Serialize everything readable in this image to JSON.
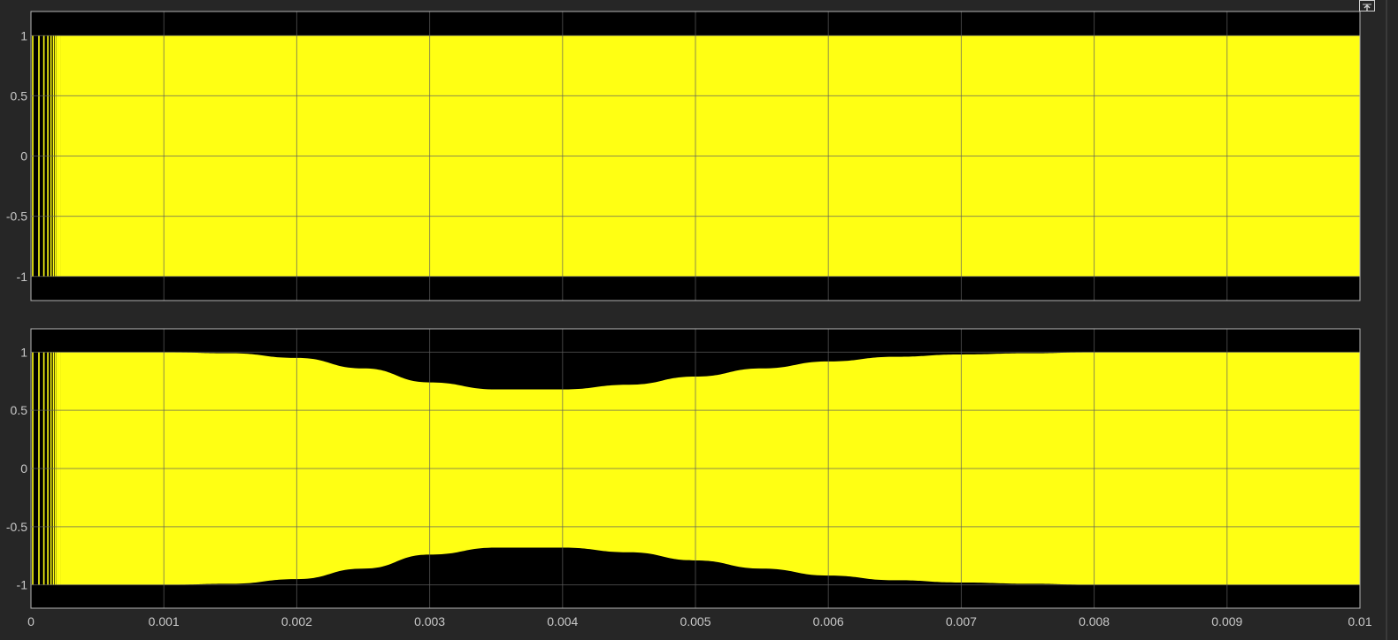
{
  "window": {
    "undock_icon": "undock-arrow-icon"
  },
  "colors": {
    "background": "#262626",
    "plot_background": "#000000",
    "signal": "#ffff13",
    "grid": "#5e5e5e",
    "axis_frame": "#b4b4b4",
    "tick_label": "#c8c8c8"
  },
  "chart_data": [
    {
      "type": "line",
      "title": "",
      "xlabel": "",
      "ylabel": "",
      "xlim": [
        0,
        0.01
      ],
      "ylim": [
        -1.2,
        1.2
      ],
      "grid": true,
      "x_tick_labels_shown": false,
      "xticks": [
        "0",
        "0.001",
        "0.002",
        "0.003",
        "0.004",
        "0.005",
        "0.006",
        "0.007",
        "0.008",
        "0.009",
        "0.01"
      ],
      "yticks": [
        "1",
        "0.5",
        "0",
        "-0.5",
        "-1"
      ],
      "series": [
        {
          "description_points": "upper/lower envelope of dense oscillation",
          "x": [
            0,
            0.0002,
            0.001,
            0.002,
            0.003,
            0.004,
            0.005,
            0.006,
            0.007,
            0.008,
            0.009,
            0.01
          ],
          "upper": [
            1,
            1,
            1,
            1,
            1,
            1,
            1,
            1,
            1,
            1,
            1,
            1
          ],
          "lower": [
            -1,
            -1,
            -1,
            -1,
            -1,
            -1,
            -1,
            -1,
            -1,
            -1,
            -1,
            -1
          ]
        }
      ]
    },
    {
      "type": "line",
      "title": "",
      "xlabel": "",
      "ylabel": "",
      "xlim": [
        0,
        0.01
      ],
      "ylim": [
        -1.2,
        1.2
      ],
      "grid": true,
      "x_tick_labels_shown": true,
      "xticks": [
        "0",
        "0.001",
        "0.002",
        "0.003",
        "0.004",
        "0.005",
        "0.006",
        "0.007",
        "0.008",
        "0.009",
        "0.01"
      ],
      "yticks": [
        "1",
        "0.5",
        "0",
        "-0.5",
        "-1"
      ],
      "series": [
        {
          "description_points": "upper/lower envelope of dense oscillation",
          "x": [
            0,
            0.0002,
            0.001,
            0.0015,
            0.002,
            0.0025,
            0.003,
            0.0035,
            0.004,
            0.0045,
            0.005,
            0.0055,
            0.006,
            0.0065,
            0.007,
            0.0075,
            0.008,
            0.009,
            0.01
          ],
          "upper": [
            1,
            1,
            1,
            0.99,
            0.95,
            0.86,
            0.74,
            0.68,
            0.68,
            0.72,
            0.79,
            0.86,
            0.92,
            0.96,
            0.98,
            0.99,
            1,
            1,
            1
          ],
          "lower": [
            -1,
            -1,
            -1,
            -0.99,
            -0.95,
            -0.86,
            -0.74,
            -0.68,
            -0.68,
            -0.72,
            -0.79,
            -0.86,
            -0.92,
            -0.96,
            -0.98,
            -0.99,
            -1,
            -1,
            -1
          ]
        }
      ]
    }
  ]
}
